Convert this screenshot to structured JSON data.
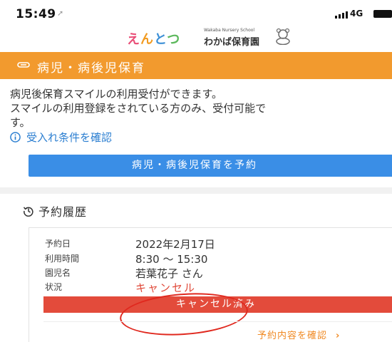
{
  "status_bar": {
    "time": "15:49",
    "network": "4G"
  },
  "logo": {
    "brand_chars": [
      "え",
      "ん",
      "と",
      "つ"
    ],
    "tagline": "Wakaba Nursery School",
    "name": "わかば保育園"
  },
  "header": {
    "title": "病児・病後児保育"
  },
  "description": {
    "lines": [
      "病児後保育スマイルの利用受付ができます。",
      "スマイルの利用登録をされている方のみ、受付可能で",
      "す。"
    ]
  },
  "conditions_link": "受入れ条件を確認",
  "reserve_button": "病児・病後児保育を予約",
  "history": {
    "title": "予約履歴",
    "record": {
      "date_label": "予約日",
      "date": "2022年2月17日",
      "time_label": "利用時間",
      "time": "8:30 〜 15:30",
      "child_label": "園児名",
      "child": "若葉花子 さん",
      "status_label": "状況",
      "status": "キャンセル",
      "cancelled_label": "キャンセル済み",
      "detail_link": "予約内容を確認"
    }
  },
  "colors": {
    "header_orange": "#f29a2e",
    "primary_blue": "#3a8ee6",
    "link_blue": "#2c7fd1",
    "cancel_red": "#e34b3b",
    "annotation_circle": "#e0281e",
    "detail_orange": "#f08a24"
  }
}
